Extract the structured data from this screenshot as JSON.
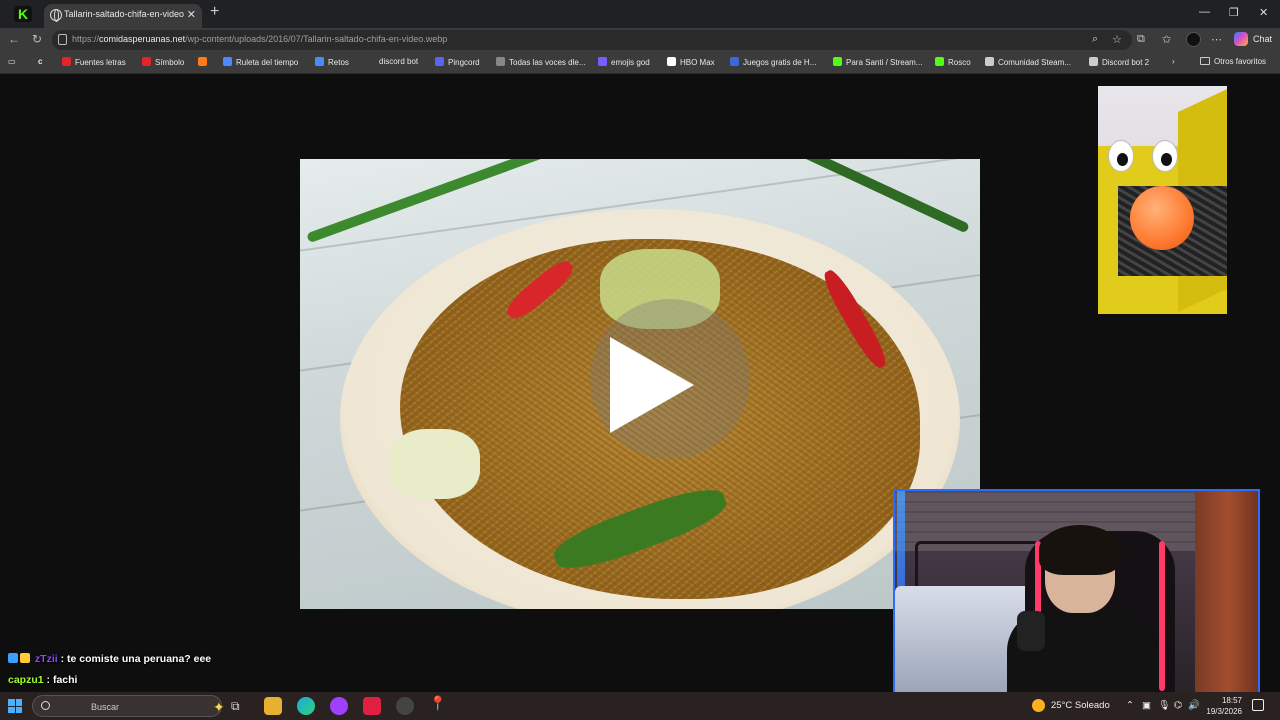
{
  "browser": {
    "tab_title": "Tallarin-saltado-chifa-en-video.webp",
    "tab_logo": "K",
    "url_domain": "comidasperuanas.net",
    "url_prefix": "https://",
    "url_path": "/wp-content/uploads/2016/07/Tallarin-saltado-chifa-en-video.webp",
    "chat_button": "Chat"
  },
  "bookmarks": {
    "items": [
      {
        "label": "Fuentes letras",
        "color": "#e0262b"
      },
      {
        "label": "Símbolo",
        "color": "#e0262b"
      },
      {
        "label": "Ruleta del tiempo",
        "color": "#4a8cff"
      },
      {
        "label": "Retos",
        "color": "#4a8cff"
      },
      {
        "label": "discord bot",
        "color": "#5865f2"
      },
      {
        "label": "Pingcord",
        "color": "#5865f2"
      },
      {
        "label": "Todas las voces dle...",
        "color": "#888888"
      },
      {
        "label": "emojis god",
        "color": "#7a5cff"
      },
      {
        "label": "HBO Max",
        "color": "#ffffff"
      },
      {
        "label": "Juegos gratis de H...",
        "color": "#3a6ad8"
      },
      {
        "label": "Para Santi / Stream...",
        "color": "#53fc18"
      },
      {
        "label": "Rosco",
        "color": "#53fc18"
      },
      {
        "label": "Comunidad Steam...",
        "color": "#cccccc"
      },
      {
        "label": "Discord bot 2",
        "color": "#cccccc"
      }
    ],
    "other": "Otros favoritos"
  },
  "chat": {
    "lines": [
      {
        "user": "zTzii",
        "message": "te comiste una peruana? eee"
      },
      {
        "user": "capzu1",
        "message": "fachi"
      }
    ]
  },
  "taskbar": {
    "search_placeholder": "Buscar",
    "weather": "25°C  Soleado",
    "time": "18:57",
    "date": "19/3/2026"
  },
  "colors": {
    "accent_cam_border": "#2b6cff",
    "kick_green": "#53fc18"
  },
  "icons": {
    "play": "play-icon",
    "start": "windows-start-icon"
  }
}
